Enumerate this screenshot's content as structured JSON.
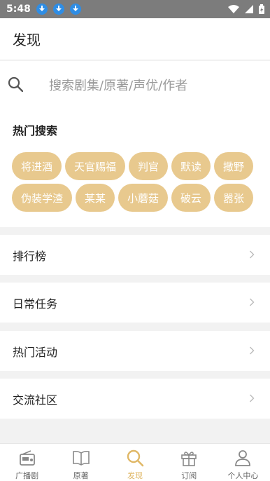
{
  "status_bar": {
    "time": "5:48"
  },
  "header": {
    "title": "发现"
  },
  "search": {
    "placeholder": "搜索剧集/原著/声优/作者"
  },
  "hot_search": {
    "title": "热门搜索",
    "tags": [
      "将进酒",
      "天官赐福",
      "判官",
      "默读",
      "撒野",
      "伪装学渣",
      "某某",
      "小蘑菇",
      "破云",
      "嚣张"
    ]
  },
  "menu": [
    {
      "label": "排行榜"
    },
    {
      "label": "日常任务"
    },
    {
      "label": "热门活动"
    },
    {
      "label": "交流社区"
    }
  ],
  "tabbar": {
    "active": "发现",
    "tabs": [
      {
        "label": "广播剧",
        "icon": "radio-icon"
      },
      {
        "label": "原著",
        "icon": "book-icon"
      },
      {
        "label": "发现",
        "icon": "search-icon"
      },
      {
        "label": "订阅",
        "icon": "gift-icon"
      },
      {
        "label": "个人中心",
        "icon": "person-icon"
      }
    ]
  },
  "colors": {
    "accent": "#e0b867",
    "tag_bg": "#e8c98e",
    "status_bar": "#7c7c7c"
  }
}
